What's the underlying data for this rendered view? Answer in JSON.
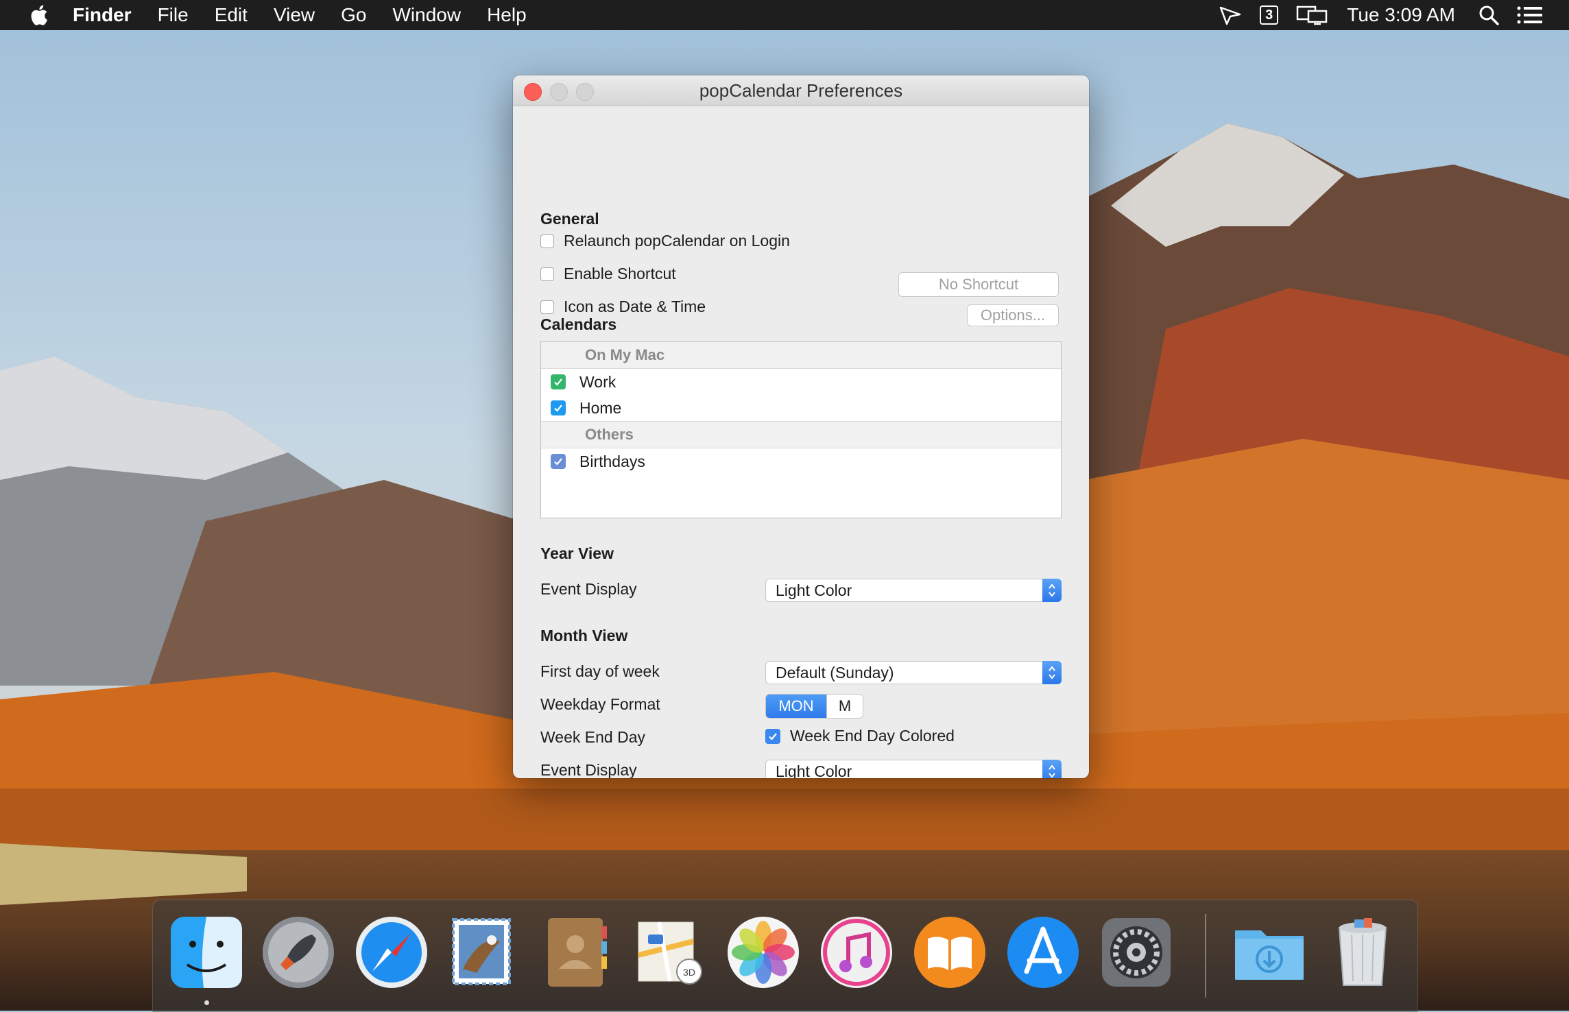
{
  "menubar": {
    "app_name": "Finder",
    "items": [
      "File",
      "Edit",
      "View",
      "Go",
      "Window",
      "Help"
    ],
    "status_badge": "3",
    "clock": "Tue 3:09 AM"
  },
  "window": {
    "title": "popCalendar Preferences",
    "general": {
      "heading": "General",
      "relaunch_label": "Relaunch popCalendar on Login",
      "relaunch_checked": false,
      "shortcut_label": "Enable Shortcut",
      "shortcut_checked": false,
      "shortcut_button": "No Shortcut",
      "icon_label": "Icon as Date & Time",
      "icon_checked": false,
      "options_button": "Options..."
    },
    "calendars": {
      "heading": "Calendars",
      "groups": [
        {
          "name": "On My Mac",
          "items": [
            {
              "label": "Work",
              "checked": true,
              "color": "#34b76c"
            },
            {
              "label": "Home",
              "checked": true,
              "color": "#1e9bf0"
            }
          ]
        },
        {
          "name": "Others",
          "items": [
            {
              "label": "Birthdays",
              "checked": true,
              "color": "#6b8fd6"
            }
          ]
        }
      ]
    },
    "year_view": {
      "heading": "Year View",
      "event_display_label": "Event Display",
      "event_display_value": "Light Color"
    },
    "month_view": {
      "heading": "Month View",
      "first_day_label": "First day of week",
      "first_day_value": "Default (Sunday)",
      "weekday_format_label": "Weekday Format",
      "weekday_options": [
        "MON",
        "M"
      ],
      "weekday_selected": "MON",
      "week_end_label": "Week End Day",
      "week_end_check_label": "Week End Day Colored",
      "week_end_checked": true,
      "event_display_label": "Event Display",
      "event_display_value": "Light Color"
    }
  },
  "dock": {
    "apps": [
      "finder-icon",
      "launchpad-icon",
      "safari-icon",
      "mail-icon",
      "contacts-icon",
      "maps-icon",
      "photos-icon",
      "itunes-icon",
      "ibooks-icon",
      "app-store-icon",
      "system-preferences-icon",
      "downloads-folder-icon",
      "trash-icon"
    ]
  },
  "colors": {
    "accent": "#2f7bec",
    "close_button": "#fc5f57"
  }
}
